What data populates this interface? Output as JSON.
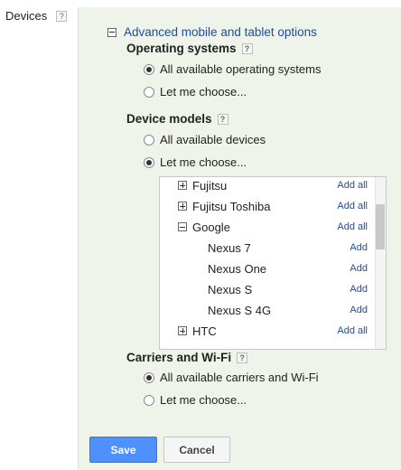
{
  "left": {
    "label": "Devices",
    "help": "?"
  },
  "advanced": {
    "title": "Advanced mobile and tablet options"
  },
  "os": {
    "title": "Operating systems",
    "options": [
      {
        "label": "All available operating systems",
        "selected": true
      },
      {
        "label": "Let me choose...",
        "selected": false
      }
    ]
  },
  "models": {
    "title": "Device models",
    "options": [
      {
        "label": "All available devices",
        "selected": false
      },
      {
        "label": "Let me choose...",
        "selected": true
      }
    ],
    "list": [
      {
        "name": "Fujitsu",
        "action": "Add all",
        "expanded": false,
        "child": false
      },
      {
        "name": "Fujitsu Toshiba",
        "action": "Add all",
        "expanded": false,
        "child": false
      },
      {
        "name": "Google",
        "action": "Add all",
        "expanded": true,
        "child": false
      },
      {
        "name": "Nexus 7",
        "action": "Add",
        "child": true
      },
      {
        "name": "Nexus One",
        "action": "Add",
        "child": true
      },
      {
        "name": "Nexus S",
        "action": "Add",
        "child": true
      },
      {
        "name": "Nexus S 4G",
        "action": "Add",
        "child": true
      },
      {
        "name": "HTC",
        "action": "Add all",
        "expanded": false,
        "child": false
      }
    ]
  },
  "carriers": {
    "title": "Carriers and Wi-Fi",
    "options": [
      {
        "label": "All available carriers and Wi-Fi",
        "selected": true
      },
      {
        "label": "Let me choose...",
        "selected": false
      }
    ]
  },
  "buttons": {
    "save": "Save",
    "cancel": "Cancel"
  },
  "colors": {
    "link": "#1f4ba8",
    "panel": "#eef4ea",
    "primary": "#4d90fe"
  }
}
